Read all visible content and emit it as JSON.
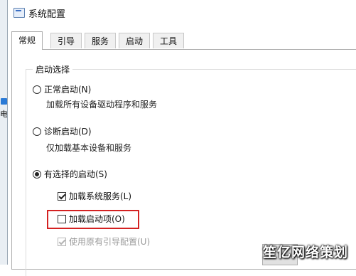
{
  "desktop": {
    "partial_text": "电"
  },
  "window": {
    "title": "系统配置"
  },
  "tabs": [
    {
      "label": "常规"
    },
    {
      "label": "引导"
    },
    {
      "label": "服务"
    },
    {
      "label": "启动"
    },
    {
      "label": "工具"
    }
  ],
  "startup_selection": {
    "legend": "启动选择",
    "normal": {
      "label": "正常启动(N)",
      "description": "加载所有设备驱动程序和服务",
      "selected": false
    },
    "diagnostic": {
      "label": "诊断启动(D)",
      "description": "仅加载基本设备和服务",
      "selected": false
    },
    "selective": {
      "label": "有选择的启动(S)",
      "selected": true,
      "options": {
        "load_system_services": {
          "label": "加载系统服务(L)",
          "checked": true
        },
        "load_startup_items": {
          "label": "加载启动项(O)",
          "checked": false
        },
        "use_original_boot_config": {
          "label": "使用原有引导配置(U)",
          "checked": true,
          "disabled": true
        }
      }
    }
  },
  "footer": {
    "partial_button_label": "关"
  },
  "watermark": {
    "text": "笙亿网络策划"
  },
  "colors": {
    "highlight": "#d42222"
  }
}
